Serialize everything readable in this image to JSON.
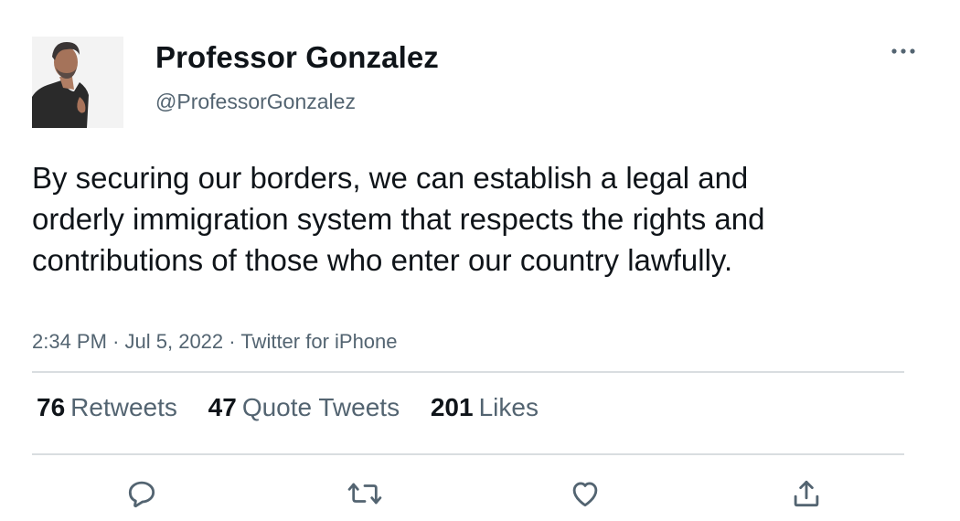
{
  "author": {
    "display_name": "Professor Gonzalez",
    "handle": "@ProfessorGonzalez",
    "avatar_icon": "person-photo"
  },
  "tweet": {
    "text": "By securing our borders, we can establish a legal and orderly immigration system that respects the rights and contributions of those who enter our country lawfully.",
    "time": "2:34 PM",
    "date": "Jul 5, 2022",
    "source": "Twitter for iPhone",
    "separator": "·"
  },
  "stats": {
    "retweets": {
      "count": "76",
      "label": "Retweets"
    },
    "quote_tweets": {
      "count": "47",
      "label": "Quote Tweets"
    },
    "likes": {
      "count": "201",
      "label": "Likes"
    }
  },
  "actions": {
    "reply_icon": "reply-icon",
    "retweet_icon": "retweet-icon",
    "like_icon": "heart-icon",
    "share_icon": "share-icon"
  },
  "colors": {
    "text_primary": "#0f1419",
    "text_secondary": "#536471",
    "divider": "#d9dde0"
  }
}
